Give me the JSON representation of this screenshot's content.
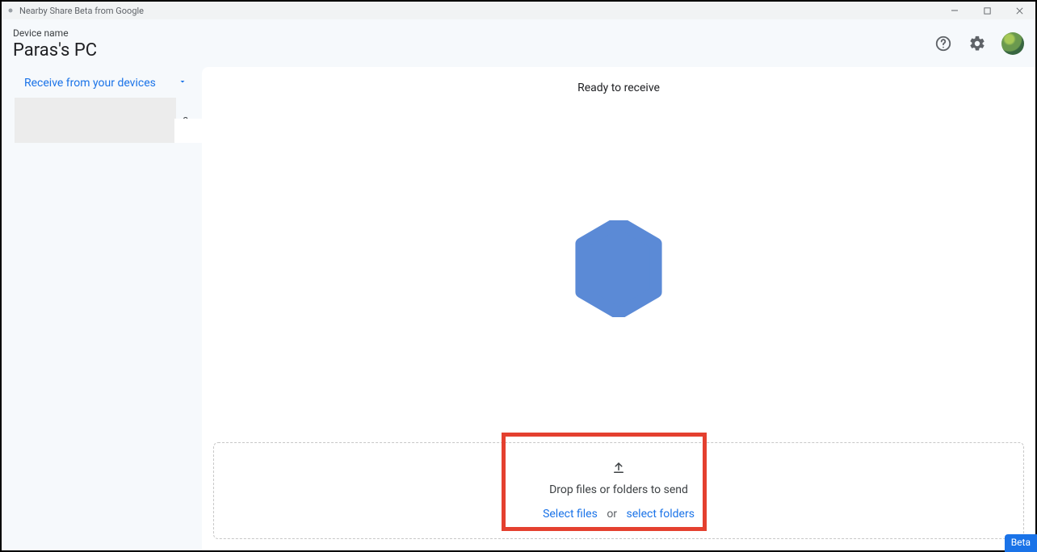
{
  "window": {
    "title": "Nearby Share Beta from Google"
  },
  "header": {
    "device_label": "Device name",
    "device_name": "Paras's PC"
  },
  "sidebar": {
    "receive_label": "Receive from your devices",
    "trailing_letter": "e"
  },
  "main": {
    "ready_text": "Ready to receive"
  },
  "dropzone": {
    "hint": "Drop files or folders to send",
    "select_files": "Select files",
    "or": "or",
    "select_folders": "select folders"
  },
  "footer": {
    "beta": "Beta"
  }
}
